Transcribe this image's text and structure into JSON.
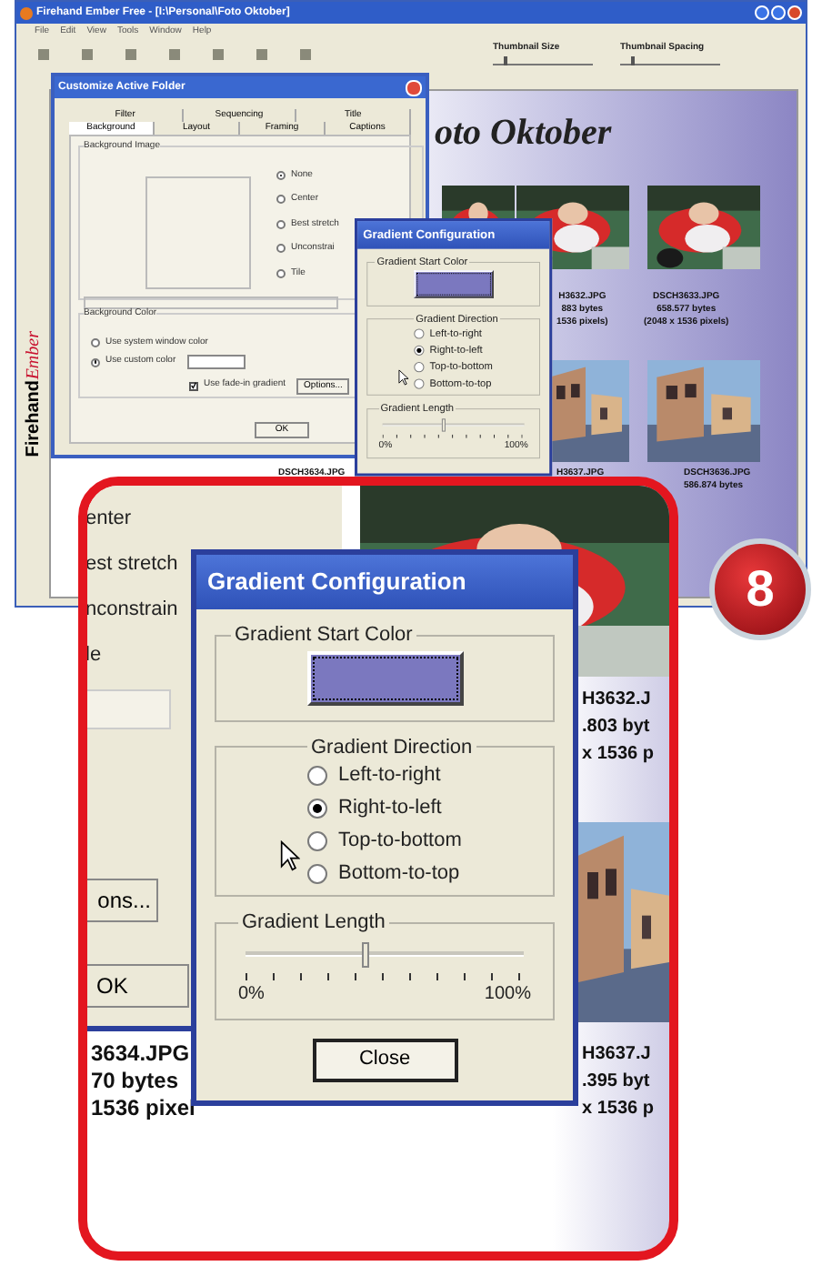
{
  "app_window": {
    "title": "Firehand Ember Free - [I:\\Personal\\Foto Oktober]",
    "menu": [
      "File",
      "Edit",
      "View",
      "Tools",
      "Window",
      "Help"
    ],
    "sliders": [
      {
        "label": "Thumbnail Size",
        "level": 0.1
      },
      {
        "label": "Thumbnail Spacing",
        "level": 0.1
      }
    ],
    "logo": {
      "first": "Firehand",
      "second": "Ember"
    },
    "folder_title": "oto Oktober",
    "captions": [
      {
        "lines": [
          "H3632.JPG",
          "883 bytes",
          "1536 pixels)"
        ]
      },
      {
        "lines": [
          "DSCH3633.JPG",
          "658.577 bytes",
          "(2048 x 1536 pixels)"
        ]
      },
      {
        "lines": [
          "DSCH3634.JPG"
        ]
      },
      {
        "lines": [
          "H3637.JPG"
        ]
      },
      {
        "lines": [
          "DSCH3636.JPG",
          "586.874 bytes"
        ]
      }
    ]
  },
  "customize_dialog": {
    "title": "Customize Active Folder",
    "tabs": [
      [
        {
          "label": "Filter",
          "selected": false
        },
        {
          "label": "Sequencing",
          "selected": false
        },
        {
          "label": "Title",
          "selected": false
        }
      ],
      [
        {
          "label": "Background",
          "selected": true
        },
        {
          "label": "Layout",
          "selected": false
        },
        {
          "label": "Framing",
          "selected": false
        },
        {
          "label": "Captions",
          "selected": false
        }
      ]
    ],
    "background_image": {
      "label": "Background Image",
      "options": [
        {
          "label": "None",
          "selected": true
        },
        {
          "label": "Center",
          "selected": false
        },
        {
          "label": "Best stretch",
          "selected": false
        },
        {
          "label": "Unconstrai",
          "selected": false
        },
        {
          "label": "Tile",
          "selected": false
        }
      ]
    },
    "background_color": {
      "label": "Background Color",
      "options": [
        {
          "label": "Use system window color",
          "selected": false
        },
        {
          "label": "Use custom color",
          "selected": true
        }
      ]
    },
    "fade_checkbox": {
      "label": "Use fade-in gradient",
      "checked": true
    },
    "options_button": "Options...",
    "ok_button": "OK"
  },
  "gradient_dialog": {
    "title": "Gradient Configuration",
    "start_color_label": "Gradient Start Color",
    "direction_label": "Gradient Direction",
    "directions": [
      {
        "label": "Left-to-right",
        "selected": false
      },
      {
        "label": "Right-to-left",
        "selected": true
      },
      {
        "label": "Top-to-bottom",
        "selected": false
      },
      {
        "label": "Bottom-to-top",
        "selected": false
      }
    ],
    "length_label": "Gradient Length",
    "length": {
      "level": 0.42
    },
    "min_label": "0%",
    "max_label": "100%"
  },
  "zoom_inset": {
    "left_texts": [
      "enter",
      "est stretch",
      "nconstrain",
      "le"
    ],
    "options_button": "ons...",
    "ok_button": "OK",
    "left_caption": [
      "3634.JPG",
      "70 bytes",
      "1536 pixel"
    ],
    "right_captions": [
      {
        "lines": [
          "H3632.J",
          ".803 byt",
          "x 1536 p"
        ]
      },
      {
        "lines": [
          "H3637.J",
          ".395 byt",
          "x 1536 p"
        ]
      }
    ],
    "gradient_dialog": {
      "title": "Gradient Configuration",
      "start_color_label": "Gradient Start Color",
      "direction_label": "Gradient Direction",
      "directions": [
        {
          "label": "Left-to-right",
          "selected": false
        },
        {
          "label": "Right-to-left",
          "selected": true
        },
        {
          "label": "Top-to-bottom",
          "selected": false
        },
        {
          "label": "Bottom-to-top",
          "selected": false
        }
      ],
      "length_label": "Gradient Length",
      "length": {
        "level": 0.42
      },
      "min_label": "0%",
      "max_label": "100%",
      "close_button": "Close"
    }
  },
  "badge": "8"
}
